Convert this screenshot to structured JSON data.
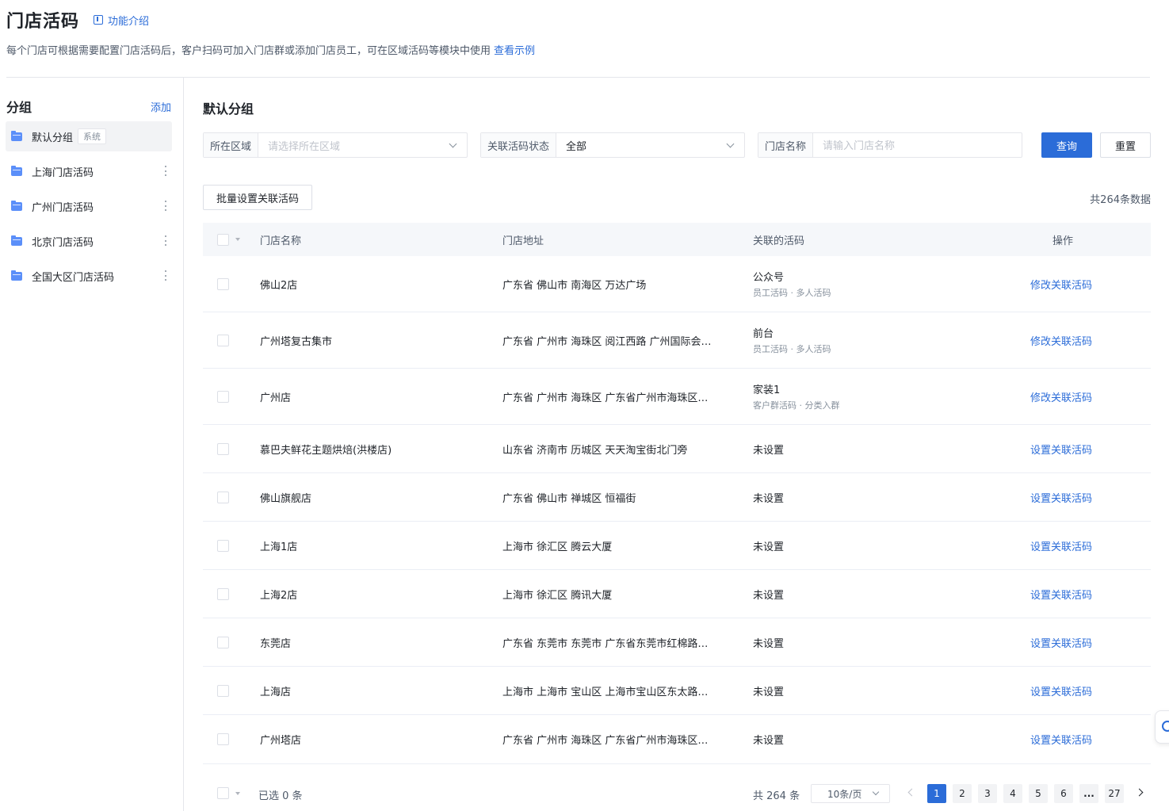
{
  "header": {
    "title": "门店活码",
    "intro_link": "功能介绍",
    "description": "每个门店可根据需要配置门店活码后，客户扫码可加入门店群或添加门店员工，可在区域活码等模块中使用",
    "example_link": "查看示例"
  },
  "sidebar": {
    "title": "分组",
    "add_label": "添加",
    "items": [
      {
        "label": "默认分组",
        "tag": "系统"
      },
      {
        "label": "上海门店活码"
      },
      {
        "label": "广州门店活码"
      },
      {
        "label": "北京门店活码"
      },
      {
        "label": "全国大区门店活码"
      }
    ]
  },
  "main": {
    "title": "默认分组",
    "filters": {
      "region": {
        "label": "所在区域",
        "placeholder": "请选择所在区域"
      },
      "status": {
        "label": "关联活码状态",
        "value": "全部"
      },
      "store": {
        "label": "门店名称",
        "placeholder": "请输入门店名称"
      }
    },
    "query_label": "查询",
    "reset_label": "重置",
    "batch_label": "批量设置关联活码",
    "total_data": "共264条数据",
    "columns": {
      "name": "门店名称",
      "address": "门店地址",
      "code": "关联的活码",
      "op": "操作"
    },
    "rows": [
      {
        "name": "佛山2店",
        "address": "广东省 佛山市 南海区 万达广场",
        "code": "公众号",
        "code_sub": "员工活码 · 多人活码",
        "op": "修改关联活码"
      },
      {
        "name": "广州塔复古集市",
        "address": "广东省 广州市 海珠区 阅江西路 广州国际会展中心",
        "code": "前台",
        "code_sub": "员工活码 · 多人活码",
        "op": "修改关联活码"
      },
      {
        "name": "广州店",
        "address": "广东省 广州市 海珠区 广东省广州市海珠区阅江西路",
        "code": "家装1",
        "code_sub": "客户群活码 · 分类入群",
        "op": "修改关联活码"
      },
      {
        "name": "慕巴夫鲜花主题烘焙(洪楼店)",
        "address": "山东省 济南市 历城区 天天淘宝街北门旁",
        "code": "未设置",
        "op": "设置关联活码"
      },
      {
        "name": "佛山旗舰店",
        "address": "广东省 佛山市 禅城区 恒福街",
        "code": "未设置",
        "op": "设置关联活码"
      },
      {
        "name": "上海1店",
        "address": "上海市 徐汇区 腾云大厦",
        "code": "未设置",
        "op": "设置关联活码"
      },
      {
        "name": "上海2店",
        "address": "上海市 徐汇区 腾讯大厦",
        "code": "未设置",
        "op": "设置关联活码"
      },
      {
        "name": "东莞店",
        "address": "广东省 东莞市 东莞市 广东省东莞市红棉路东莞广场",
        "code": "未设置",
        "op": "设置关联活码"
      },
      {
        "name": "上海店",
        "address": "上海市 上海市 宝山区 上海市宝山区东太路大厦",
        "code": "未设置",
        "op": "设置关联活码"
      },
      {
        "name": "广州塔店",
        "address": "广东省 广州市 海珠区 广东省广州市海珠区阅江西路",
        "code": "未设置",
        "op": "设置关联活码"
      }
    ]
  },
  "footer": {
    "selected": "已选 0 条",
    "total": "共 264 条",
    "page_size": "10条/页",
    "pages": [
      "1",
      "2",
      "3",
      "4",
      "5",
      "6",
      "...",
      "27"
    ],
    "current_page": 1
  },
  "colors": {
    "accent": "#2b6cd8",
    "folder": "#5b8ff9"
  }
}
